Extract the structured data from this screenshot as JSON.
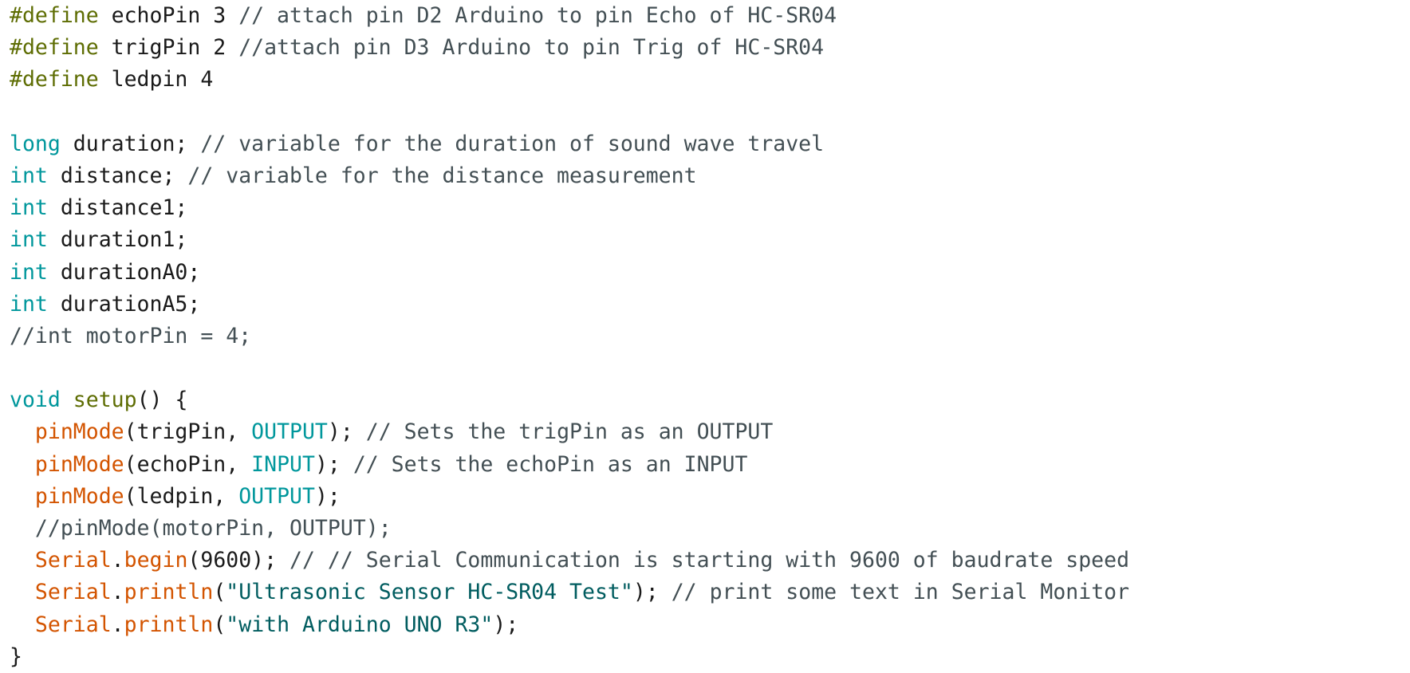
{
  "editor": {
    "language": "Arduino C++",
    "colors": {
      "preprocessor": "#5e6d03",
      "type": "#00979c",
      "function": "#d35400",
      "constant": "#00979c",
      "string": "#005c5f",
      "comment": "#434f54",
      "plain": "#1a1a1a",
      "background": "#ffffff"
    },
    "lines": [
      [
        {
          "t": "pre",
          "v": "#define"
        },
        {
          "t": "plain",
          "v": " echoPin 3 "
        },
        {
          "t": "com",
          "v": "// attach pin D2 Arduino to pin Echo of HC-SR04"
        }
      ],
      [
        {
          "t": "pre",
          "v": "#define"
        },
        {
          "t": "plain",
          "v": " trigPin 2 "
        },
        {
          "t": "com",
          "v": "//attach pin D3 Arduino to pin Trig of HC-SR04"
        }
      ],
      [
        {
          "t": "pre",
          "v": "#define"
        },
        {
          "t": "plain",
          "v": " ledpin 4"
        }
      ],
      [],
      [
        {
          "t": "type",
          "v": "long"
        },
        {
          "t": "plain",
          "v": " duration; "
        },
        {
          "t": "com",
          "v": "// variable for the duration of sound wave travel"
        }
      ],
      [
        {
          "t": "type",
          "v": "int"
        },
        {
          "t": "plain",
          "v": " distance; "
        },
        {
          "t": "com",
          "v": "// variable for the distance measurement"
        }
      ],
      [
        {
          "t": "type",
          "v": "int"
        },
        {
          "t": "plain",
          "v": " distance1;"
        }
      ],
      [
        {
          "t": "type",
          "v": "int"
        },
        {
          "t": "plain",
          "v": " duration1;"
        }
      ],
      [
        {
          "t": "type",
          "v": "int"
        },
        {
          "t": "plain",
          "v": " durationA0;"
        }
      ],
      [
        {
          "t": "type",
          "v": "int"
        },
        {
          "t": "plain",
          "v": " durationA5;"
        }
      ],
      [
        {
          "t": "com",
          "v": "//int motorPin = 4;"
        }
      ],
      [],
      [
        {
          "t": "type",
          "v": "void"
        },
        {
          "t": "plain",
          "v": " "
        },
        {
          "t": "pre",
          "v": "setup"
        },
        {
          "t": "plain",
          "v": "() {"
        }
      ],
      [
        {
          "t": "plain",
          "v": "  "
        },
        {
          "t": "func",
          "v": "pinMode"
        },
        {
          "t": "plain",
          "v": "(trigPin, "
        },
        {
          "t": "const",
          "v": "OUTPUT"
        },
        {
          "t": "plain",
          "v": "); "
        },
        {
          "t": "com",
          "v": "// Sets the trigPin as an OUTPUT"
        }
      ],
      [
        {
          "t": "plain",
          "v": "  "
        },
        {
          "t": "func",
          "v": "pinMode"
        },
        {
          "t": "plain",
          "v": "(echoPin, "
        },
        {
          "t": "const",
          "v": "INPUT"
        },
        {
          "t": "plain",
          "v": "); "
        },
        {
          "t": "com",
          "v": "// Sets the echoPin as an INPUT"
        }
      ],
      [
        {
          "t": "plain",
          "v": "  "
        },
        {
          "t": "func",
          "v": "pinMode"
        },
        {
          "t": "plain",
          "v": "(ledpin, "
        },
        {
          "t": "const",
          "v": "OUTPUT"
        },
        {
          "t": "plain",
          "v": ");"
        }
      ],
      [
        {
          "t": "plain",
          "v": "  "
        },
        {
          "t": "com",
          "v": "//pinMode(motorPin, OUTPUT);"
        }
      ],
      [
        {
          "t": "plain",
          "v": "  "
        },
        {
          "t": "func",
          "v": "Serial"
        },
        {
          "t": "plain",
          "v": "."
        },
        {
          "t": "func",
          "v": "begin"
        },
        {
          "t": "plain",
          "v": "(9600); "
        },
        {
          "t": "com",
          "v": "// // Serial Communication is starting with 9600 of baudrate speed"
        }
      ],
      [
        {
          "t": "plain",
          "v": "  "
        },
        {
          "t": "func",
          "v": "Serial"
        },
        {
          "t": "plain",
          "v": "."
        },
        {
          "t": "func",
          "v": "println"
        },
        {
          "t": "plain",
          "v": "("
        },
        {
          "t": "str",
          "v": "\"Ultrasonic Sensor HC-SR04 Test\""
        },
        {
          "t": "plain",
          "v": "); "
        },
        {
          "t": "com",
          "v": "// print some text in Serial Monitor"
        }
      ],
      [
        {
          "t": "plain",
          "v": "  "
        },
        {
          "t": "func",
          "v": "Serial"
        },
        {
          "t": "plain",
          "v": "."
        },
        {
          "t": "func",
          "v": "println"
        },
        {
          "t": "plain",
          "v": "("
        },
        {
          "t": "str",
          "v": "\"with Arduino UNO R3\""
        },
        {
          "t": "plain",
          "v": ");"
        }
      ],
      [
        {
          "t": "plain",
          "v": "}"
        }
      ]
    ]
  }
}
